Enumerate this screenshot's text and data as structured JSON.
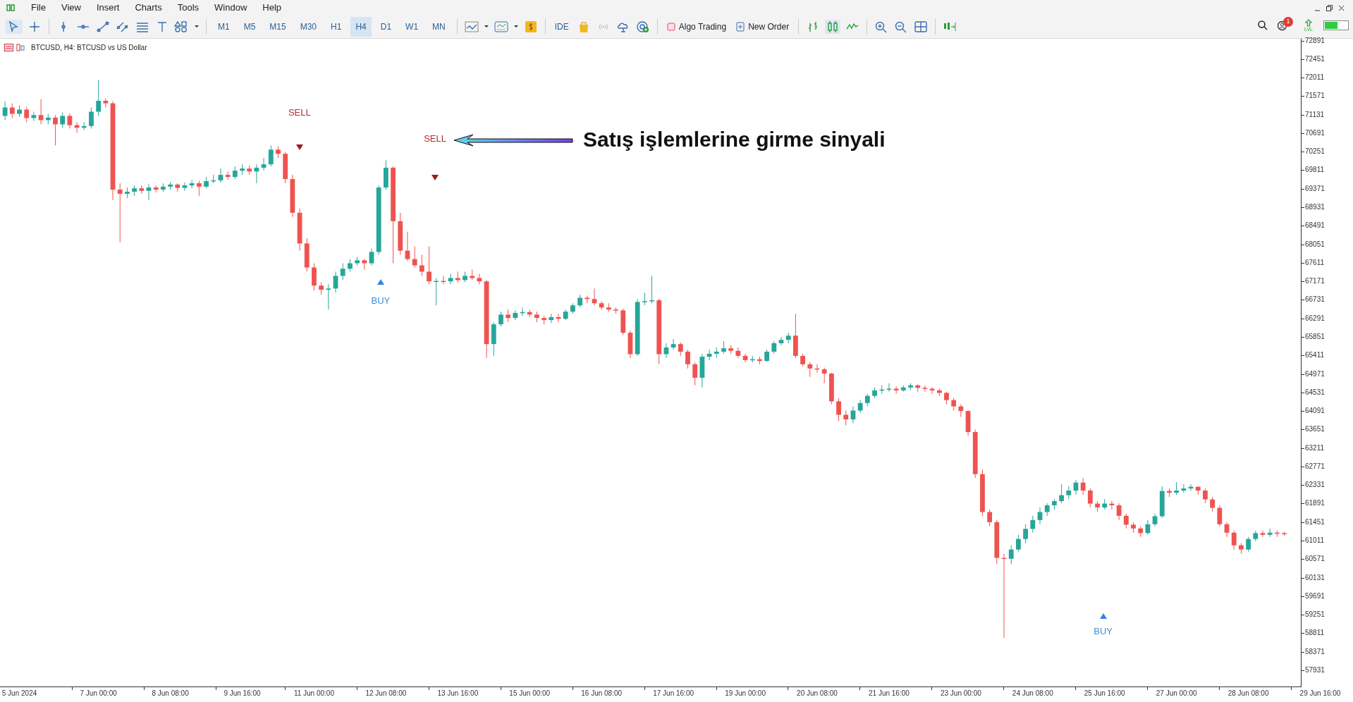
{
  "menu": [
    "File",
    "View",
    "Insert",
    "Charts",
    "Tools",
    "Window",
    "Help"
  ],
  "toolbar": {
    "timeframes": [
      {
        "label": "M1",
        "selected": false
      },
      {
        "label": "M5",
        "selected": false
      },
      {
        "label": "M15",
        "selected": false
      },
      {
        "label": "M30",
        "selected": false
      },
      {
        "label": "H1",
        "selected": false
      },
      {
        "label": "H4",
        "selected": true
      },
      {
        "label": "D1",
        "selected": false
      },
      {
        "label": "W1",
        "selected": false
      },
      {
        "label": "MN",
        "selected": false
      }
    ],
    "ide": "IDE",
    "algo_trading": "Algo Trading",
    "new_order": "New Order",
    "notification_count": "1",
    "lvl_label": "LVL"
  },
  "chart": {
    "title": "BTCUSD, H4:  BTCUSD vs US Dollar",
    "chart_data": {
      "type": "candlestick",
      "ylim": [
        57529,
        72933
      ],
      "yticks": [
        {
          "value": 72891,
          "label": "72891"
        },
        {
          "value": 72451,
          "label": "72451"
        },
        {
          "value": 72011,
          "label": "72011"
        },
        {
          "value": 71571,
          "label": "71571"
        },
        {
          "value": 71131,
          "label": "71131"
        },
        {
          "value": 70691,
          "label": "70691"
        },
        {
          "value": 70251,
          "label": "70251"
        },
        {
          "value": 69811,
          "label": "69811"
        },
        {
          "value": 69371,
          "label": "69371"
        },
        {
          "value": 68931,
          "label": "68931"
        },
        {
          "value": 68491,
          "label": "68491"
        },
        {
          "value": 68051,
          "label": "68051"
        },
        {
          "value": 67611,
          "label": "67611"
        },
        {
          "value": 67171,
          "label": "67171"
        },
        {
          "value": 66731,
          "label": "66731"
        },
        {
          "value": 66291,
          "label": "66291"
        },
        {
          "value": 65851,
          "label": "65851"
        },
        {
          "value": 65411,
          "label": "65411"
        },
        {
          "value": 64971,
          "label": "64971"
        },
        {
          "value": 64531,
          "label": "64531"
        },
        {
          "value": 64091,
          "label": "64091"
        },
        {
          "value": 63651,
          "label": "63651"
        },
        {
          "value": 63211,
          "label": "63211"
        },
        {
          "value": 62771,
          "label": "62771"
        },
        {
          "value": 62331,
          "label": "62331"
        },
        {
          "value": 61891,
          "label": "61891"
        },
        {
          "value": 61451,
          "label": "61451"
        },
        {
          "value": 61011,
          "label": "61011"
        },
        {
          "value": 60571,
          "label": "60571"
        },
        {
          "value": 60131,
          "label": "60131"
        },
        {
          "value": 59691,
          "label": "59691"
        },
        {
          "value": 59251,
          "label": "59251"
        },
        {
          "value": 58811,
          "label": "58811"
        },
        {
          "value": 58371,
          "label": "58371"
        },
        {
          "value": 57931,
          "label": "57931"
        }
      ],
      "categories": [
        null,
        null,
        "5 Jun 2024",
        null,
        null,
        null,
        null,
        null,
        null,
        null,
        null,
        null,
        null,
        "7 Jun 00:00",
        null,
        null,
        null,
        null,
        null,
        null,
        null,
        null,
        null,
        "8 Jun 08:00",
        null,
        null,
        null,
        null,
        null,
        null,
        null,
        null,
        null,
        "9 Jun 16:00",
        null,
        null,
        null,
        null,
        null,
        null,
        null,
        null,
        null,
        "11 Jun 00:00",
        null,
        null,
        null,
        null,
        null,
        null,
        null,
        null,
        null,
        "12 Jun 08:00",
        null,
        null,
        null,
        null,
        null,
        null,
        null,
        null,
        null,
        "13 Jun 16:00",
        null,
        null,
        null,
        null,
        null,
        null,
        null,
        null,
        null,
        "15 Jun 00:00",
        null,
        null,
        null,
        null,
        null,
        null,
        null,
        null,
        null,
        "16 Jun 08:00",
        null,
        null,
        null,
        null,
        null,
        null,
        null,
        null,
        null,
        "17 Jun 16:00",
        null,
        null,
        null,
        null,
        null,
        null,
        null,
        null,
        null,
        "19 Jun 00:00",
        null,
        null,
        null,
        null,
        null,
        null,
        null,
        null,
        null,
        "20 Jun 08:00",
        null,
        null,
        null,
        null,
        null,
        null,
        null,
        null,
        null,
        "21 Jun 16:00",
        null,
        null,
        null,
        null,
        null,
        null,
        null,
        null,
        null,
        "23 Jun 00:00",
        null,
        null,
        null,
        null,
        null,
        null,
        null,
        null,
        null,
        "24 Jun 08:00",
        null,
        null,
        null,
        null,
        null,
        null,
        null,
        null,
        null,
        "25 Jun 16:00",
        null,
        null,
        null,
        null,
        null,
        null,
        null,
        null,
        null,
        "27 Jun 00:00",
        null,
        null,
        null,
        null,
        null,
        null,
        null,
        null,
        null,
        "28 Jun 08:00",
        null,
        null,
        null,
        null,
        null,
        null,
        null,
        null,
        null,
        "29 Jun 16:00"
      ],
      "ohlc": [
        [
          71100,
          71450,
          71000,
          71300
        ],
        [
          71300,
          71400,
          71050,
          71150
        ],
        [
          71150,
          71350,
          71080,
          71250
        ],
        [
          71250,
          71320,
          70950,
          71050
        ],
        [
          71050,
          71200,
          70980,
          71120
        ],
        [
          71120,
          71500,
          70900,
          71000
        ],
        [
          71000,
          71150,
          70900,
          71060
        ],
        [
          71060,
          71120,
          70400,
          70900
        ],
        [
          70900,
          71180,
          70820,
          71100
        ],
        [
          71100,
          71160,
          70800,
          70880
        ],
        [
          70880,
          70950,
          70700,
          70820
        ],
        [
          70820,
          70950,
          70760,
          70860
        ],
        [
          70860,
          71300,
          70800,
          71200
        ],
        [
          71200,
          71950,
          71100,
          71460
        ],
        [
          71460,
          71520,
          71300,
          71400
        ],
        [
          71400,
          71450,
          69100,
          69350
        ],
        [
          69350,
          69500,
          68100,
          69250
        ],
        [
          69250,
          69400,
          69150,
          69300
        ],
        [
          69300,
          69450,
          69200,
          69380
        ],
        [
          69380,
          69450,
          69250,
          69320
        ],
        [
          69320,
          69480,
          69100,
          69400
        ],
        [
          69400,
          69450,
          69280,
          69350
        ],
        [
          69350,
          69500,
          69300,
          69420
        ],
        [
          69420,
          69530,
          69350,
          69470
        ],
        [
          69470,
          69500,
          69300,
          69390
        ],
        [
          69390,
          69520,
          69320,
          69450
        ],
        [
          69450,
          69580,
          69380,
          69500
        ],
        [
          69500,
          69560,
          69200,
          69420
        ],
        [
          69420,
          69650,
          69380,
          69550
        ],
        [
          69550,
          69700,
          69500,
          69570
        ],
        [
          69570,
          69850,
          69520,
          69700
        ],
        [
          69700,
          69780,
          69580,
          69650
        ],
        [
          69650,
          69900,
          69600,
          69800
        ],
        [
          69800,
          69950,
          69700,
          69850
        ],
        [
          69850,
          69920,
          69700,
          69780
        ],
        [
          69780,
          69950,
          69500,
          69870
        ],
        [
          69870,
          70100,
          69800,
          69950
        ],
        [
          69950,
          70400,
          69900,
          70300
        ],
        [
          70300,
          70380,
          70100,
          70200
        ],
        [
          70200,
          70250,
          69500,
          69600
        ],
        [
          69600,
          69700,
          68700,
          68800
        ],
        [
          68800,
          68900,
          67900,
          68070
        ],
        [
          68070,
          68200,
          67400,
          67500
        ],
        [
          67500,
          67600,
          66950,
          67070
        ],
        [
          67070,
          67150,
          66850,
          66970
        ],
        [
          66970,
          67100,
          66500,
          67000
        ],
        [
          67000,
          67400,
          66900,
          67300
        ],
        [
          67300,
          67600,
          67200,
          67470
        ],
        [
          67470,
          67700,
          67400,
          67600
        ],
        [
          67600,
          67750,
          67550,
          67670
        ],
        [
          67670,
          67700,
          67450,
          67600
        ],
        [
          67600,
          67950,
          67550,
          67870
        ],
        [
          67870,
          69450,
          67800,
          69400
        ],
        [
          69400,
          70050,
          69350,
          69870
        ],
        [
          69870,
          69900,
          67600,
          68600
        ],
        [
          68600,
          68800,
          67800,
          67900
        ],
        [
          67900,
          68350,
          67650,
          67700
        ],
        [
          67700,
          68000,
          67500,
          67550
        ],
        [
          67550,
          67800,
          67300,
          67400
        ],
        [
          67400,
          68000,
          67100,
          67170
        ],
        [
          67170,
          67250,
          66600,
          67180
        ],
        [
          67180,
          67300,
          67100,
          67170
        ],
        [
          67170,
          67350,
          67100,
          67250
        ],
        [
          67250,
          67400,
          67150,
          67200
        ],
        [
          67200,
          67400,
          67150,
          67300
        ],
        [
          67300,
          67450,
          67200,
          67250
        ],
        [
          67250,
          67350,
          67100,
          67170
        ],
        [
          67170,
          67200,
          65350,
          65680
        ],
        [
          65680,
          66200,
          65400,
          66150
        ],
        [
          66150,
          66450,
          66100,
          66380
        ],
        [
          66380,
          66500,
          66200,
          66300
        ],
        [
          66300,
          66480,
          66250,
          66420
        ],
        [
          66420,
          66550,
          66350,
          66440
        ],
        [
          66440,
          66500,
          66320,
          66380
        ],
        [
          66380,
          66450,
          66200,
          66300
        ],
        [
          66300,
          66350,
          66150,
          66250
        ],
        [
          66250,
          66400,
          66180,
          66320
        ],
        [
          66320,
          66400,
          66200,
          66280
        ],
        [
          66280,
          66500,
          66250,
          66450
        ],
        [
          66450,
          66650,
          66400,
          66600
        ],
        [
          66600,
          66850,
          66550,
          66780
        ],
        [
          66780,
          66830,
          66650,
          66750
        ],
        [
          66750,
          67000,
          66600,
          66650
        ],
        [
          66650,
          66700,
          66500,
          66550
        ],
        [
          66550,
          66650,
          66450,
          66500
        ],
        [
          66500,
          66550,
          66400,
          66480
        ],
        [
          66480,
          66520,
          65900,
          65950
        ],
        [
          65950,
          66000,
          65350,
          65440
        ],
        [
          65440,
          66750,
          65400,
          66680
        ],
        [
          66680,
          66900,
          66600,
          66700
        ],
        [
          66700,
          67300,
          66650,
          66720
        ],
        [
          66720,
          66760,
          65200,
          65440
        ],
        [
          65440,
          65700,
          65350,
          65600
        ],
        [
          65600,
          65800,
          65550,
          65680
        ],
        [
          65680,
          65720,
          65400,
          65500
        ],
        [
          65500,
          65550,
          65100,
          65200
        ],
        [
          65200,
          65250,
          64700,
          64880
        ],
        [
          64880,
          65450,
          64650,
          65380
        ],
        [
          65380,
          65550,
          65300,
          65450
        ],
        [
          65450,
          65600,
          65350,
          65500
        ],
        [
          65500,
          65750,
          65450,
          65580
        ],
        [
          65580,
          65650,
          65450,
          65520
        ],
        [
          65520,
          65600,
          65350,
          65400
        ],
        [
          65400,
          65450,
          65250,
          65300
        ],
        [
          65300,
          65400,
          65250,
          65320
        ],
        [
          65320,
          65380,
          65200,
          65280
        ],
        [
          65280,
          65550,
          65250,
          65500
        ],
        [
          65500,
          65750,
          65450,
          65700
        ],
        [
          65700,
          65850,
          65650,
          65780
        ],
        [
          65780,
          65950,
          65700,
          65880
        ],
        [
          65880,
          66400,
          65350,
          65400
        ],
        [
          65400,
          65450,
          65150,
          65200
        ],
        [
          65200,
          65250,
          64900,
          65100
        ],
        [
          65100,
          65200,
          65000,
          65080
        ],
        [
          65080,
          65120,
          64750,
          64980
        ],
        [
          64980,
          65000,
          64250,
          64320
        ],
        [
          64320,
          64400,
          63850,
          64000
        ],
        [
          64000,
          64100,
          63750,
          63890
        ],
        [
          63890,
          64200,
          63800,
          64100
        ],
        [
          64100,
          64350,
          64050,
          64280
        ],
        [
          64280,
          64500,
          64200,
          64450
        ],
        [
          64450,
          64650,
          64400,
          64580
        ],
        [
          64580,
          64700,
          64500,
          64600
        ],
        [
          64600,
          64750,
          64550,
          64620
        ],
        [
          64620,
          64680,
          64500,
          64580
        ],
        [
          64580,
          64700,
          64550,
          64650
        ],
        [
          64650,
          64750,
          64600,
          64700
        ],
        [
          64700,
          64720,
          64550,
          64640
        ],
        [
          64640,
          64700,
          64550,
          64620
        ],
        [
          64620,
          64650,
          64500,
          64580
        ],
        [
          64580,
          64620,
          64450,
          64520
        ],
        [
          64520,
          64550,
          64250,
          64350
        ],
        [
          64350,
          64400,
          64100,
          64200
        ],
        [
          64200,
          64250,
          63950,
          64090
        ],
        [
          64090,
          64100,
          63500,
          63590
        ],
        [
          63590,
          63650,
          62500,
          62590
        ],
        [
          62590,
          62700,
          61600,
          61690
        ],
        [
          61690,
          61750,
          61350,
          61450
        ],
        [
          61450,
          61500,
          60450,
          60600
        ],
        [
          60600,
          60700,
          58700,
          60580
        ],
        [
          60580,
          60900,
          60450,
          60800
        ],
        [
          60800,
          61150,
          60750,
          61050
        ],
        [
          61050,
          61400,
          60950,
          61290
        ],
        [
          61290,
          61600,
          61200,
          61500
        ],
        [
          61500,
          61800,
          61400,
          61690
        ],
        [
          61690,
          61900,
          61600,
          61850
        ],
        [
          61850,
          62000,
          61750,
          61950
        ],
        [
          61950,
          62350,
          61900,
          62090
        ],
        [
          62090,
          62300,
          62000,
          62200
        ],
        [
          62200,
          62450,
          62100,
          62390
        ],
        [
          62390,
          62500,
          62100,
          62200
        ],
        [
          62200,
          62250,
          61800,
          61890
        ],
        [
          61890,
          61950,
          61700,
          61800
        ],
        [
          61800,
          62000,
          61750,
          61890
        ],
        [
          61890,
          61950,
          61750,
          61850
        ],
        [
          61850,
          61900,
          61500,
          61600
        ],
        [
          61600,
          61650,
          61300,
          61390
        ],
        [
          61390,
          61450,
          61200,
          61300
        ],
        [
          61300,
          61350,
          61100,
          61190
        ],
        [
          61190,
          61500,
          61150,
          61400
        ],
        [
          61400,
          61650,
          61350,
          61590
        ],
        [
          61590,
          62300,
          61550,
          62190
        ],
        [
          62190,
          62250,
          62050,
          62150
        ],
        [
          62150,
          62400,
          62100,
          62200
        ],
        [
          62200,
          62350,
          62150,
          62250
        ],
        [
          62250,
          62350,
          62200,
          62290
        ],
        [
          62290,
          62300,
          62100,
          62200
        ],
        [
          62200,
          62250,
          61900,
          61990
        ],
        [
          61990,
          62050,
          61700,
          61790
        ],
        [
          61790,
          61850,
          61350,
          61400
        ],
        [
          61400,
          61450,
          61100,
          61200
        ],
        [
          61200,
          61250,
          60800,
          60900
        ],
        [
          60900,
          60950,
          60700,
          60800
        ],
        [
          60800,
          61100,
          60750,
          61050
        ],
        [
          61050,
          61250,
          61000,
          61190
        ],
        [
          61190,
          61250,
          61100,
          61150
        ],
        [
          61150,
          61300,
          61100,
          61200
        ],
        [
          61200,
          61250,
          61100,
          61190
        ],
        [
          61190,
          61220,
          61120,
          61180
        ],
        null,
        null,
        null,
        null,
        null
      ]
    },
    "signals": [
      {
        "kind": "sell",
        "label": "SELL"
      },
      {
        "kind": "sell",
        "label": "SELL"
      },
      {
        "kind": "buy",
        "label": "BUY"
      },
      {
        "kind": "buy",
        "label": "BUY"
      }
    ],
    "annotation": "Satış işlemlerine girme sinyali"
  }
}
